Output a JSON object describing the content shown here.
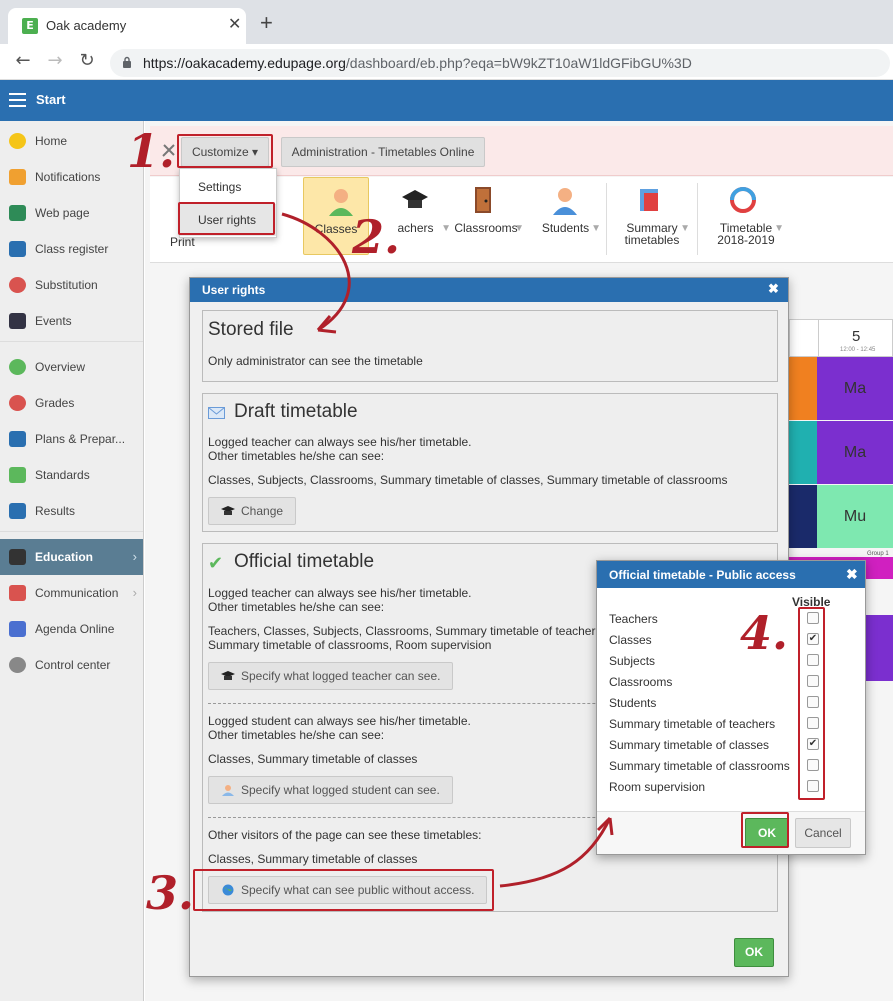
{
  "browser": {
    "tab_title": "Oak academy",
    "tab_icon_letter": "E",
    "url_host": "https://oakacademy.edupage.org",
    "url_path": "/dashboard/eb.php?eqa=bW9kZT10aW1ldGFibGU%3D"
  },
  "app": {
    "start_label": "Start"
  },
  "sidebar": {
    "items": [
      {
        "label": "Home",
        "icon": "star-icon",
        "color": "#f5c518"
      },
      {
        "label": "Notifications",
        "icon": "envelope-icon",
        "color": "#f0a030"
      },
      {
        "label": "Web page",
        "icon": "house-icon",
        "color": "#2e8b57"
      },
      {
        "label": "Class register",
        "icon": "book-icon",
        "color": "#2a6fb0"
      },
      {
        "label": "Substitution",
        "icon": "person-icon",
        "color": "#d9534f"
      },
      {
        "label": "Events",
        "icon": "calendar-icon",
        "color": "#334"
      },
      {
        "label": "Overview",
        "icon": "check-circle-icon",
        "color": "#5cb85c"
      },
      {
        "label": "Grades",
        "icon": "grades-icon",
        "color": "#d9534f"
      },
      {
        "label": "Plans & Prepar...",
        "icon": "briefcase-icon",
        "color": "#2a6fb0"
      },
      {
        "label": "Standards",
        "icon": "shield-check-icon",
        "color": "#5cb85c"
      },
      {
        "label": "Results",
        "icon": "bar-chart-icon",
        "color": "#2a6fb0"
      },
      {
        "label": "Education",
        "icon": "open-book-icon",
        "color": "#333"
      },
      {
        "label": "Communication",
        "icon": "chat-icon",
        "color": "#d9534f"
      },
      {
        "label": "Agenda Online",
        "icon": "pen-icon",
        "color": "#4a6fd0"
      },
      {
        "label": "Control center",
        "icon": "gear-icon",
        "color": "#888"
      }
    ]
  },
  "toolbar": {
    "customize_label": "Customize ▾",
    "admin_label": "Administration - Timetables Online"
  },
  "dropdown": {
    "settings_label": "Settings",
    "user_rights_label": "User rights"
  },
  "ribbon": {
    "print_label": "Print",
    "teachers_partial": "ts",
    "classes_label": "Classes",
    "teachers_label": "achers",
    "classrooms_label": "Classrooms",
    "students_label": "Students",
    "summary_label_1": "Summary",
    "summary_label_2": "timetables",
    "timetable_label_1": "Timetable",
    "timetable_label_2": "2018-2019"
  },
  "timetable_bg": {
    "period_number": "5",
    "period_time": "12:00 - 12:45",
    "cells": [
      "Ma",
      "Ma",
      "Mu"
    ],
    "cell_colors": [
      "#7b2fcf",
      "#7b2fcf",
      "#7ee8b0"
    ],
    "side_colors": [
      "#f08020",
      "#20b0b0",
      "#1a2a6a"
    ],
    "group_label": "Group 1"
  },
  "user_rights": {
    "title": "User rights",
    "stored": {
      "title": "Stored file",
      "text": "Only administrator can see the timetable"
    },
    "draft": {
      "title": "Draft timetable",
      "line1": "Logged teacher can always see his/her timetable.",
      "line2": "Other timetables he/she can see:",
      "list": "Classes, Subjects, Classrooms, Summary timetable of classes, Summary timetable of classrooms",
      "button": "Change"
    },
    "official": {
      "title": "Official timetable",
      "teacher_line1": "Logged teacher can always see his/her timetable.",
      "teacher_line2": "Other timetables he/she can see:",
      "teacher_list1": "Teachers, Classes, Subjects, Classrooms, Summary timetable of teacher",
      "teacher_list2": "Summary timetable of classrooms, Room supervision",
      "teacher_button": "Specify what logged teacher can see.",
      "student_line1": "Logged student can always see his/her timetable.",
      "student_line2": "Other timetables he/she can see:",
      "student_list": "Classes, Summary timetable of classes",
      "student_button": "Specify what logged student can see.",
      "public_line": "Other visitors of the page can see these timetables:",
      "public_list": "Classes, Summary timetable of classes",
      "public_button": "Specify what can see public without access."
    },
    "ok_label": "OK"
  },
  "public_access": {
    "title": "Official timetable - Public access",
    "visible_header": "Visible",
    "rows": [
      {
        "label": "Teachers",
        "checked": false
      },
      {
        "label": "Classes",
        "checked": true
      },
      {
        "label": "Subjects",
        "checked": false
      },
      {
        "label": "Classrooms",
        "checked": false
      },
      {
        "label": "Students",
        "checked": false
      },
      {
        "label": "Summary timetable of teachers",
        "checked": false
      },
      {
        "label": "Summary timetable of classes",
        "checked": true
      },
      {
        "label": "Summary timetable of classrooms",
        "checked": false
      },
      {
        "label": "Room supervision",
        "checked": false
      }
    ],
    "ok_label": "OK",
    "cancel_label": "Cancel"
  },
  "annotations": {
    "step1": "1.",
    "step2": "2.",
    "step3": "3.",
    "step4": "4."
  },
  "colors": {
    "brand_blue": "#2a6fb0",
    "ok_green": "#5cb85c",
    "annotation_red": "#c0202a"
  }
}
